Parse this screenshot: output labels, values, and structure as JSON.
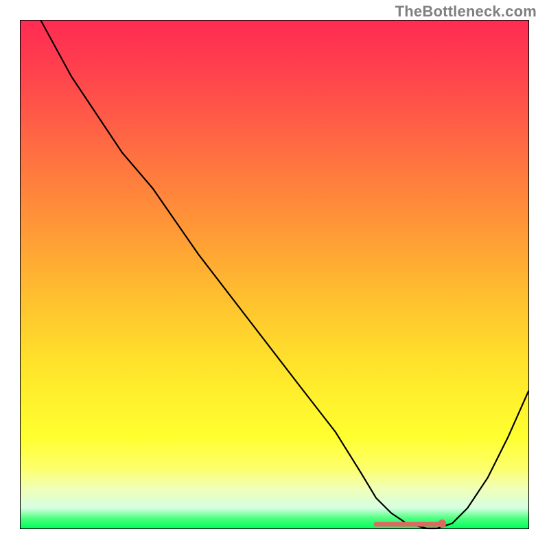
{
  "watermark": "TheBottleneck.com",
  "chart_data": {
    "type": "line",
    "title": "",
    "xlabel": "",
    "ylabel": "",
    "xlim": [
      0,
      100
    ],
    "ylim": [
      0,
      100
    ],
    "series": [
      {
        "name": "bottleneck-curve",
        "x": [
          4,
          10,
          20,
          26,
          35,
          45,
          55,
          62,
          67,
          70,
          73,
          76,
          80,
          82,
          85,
          88,
          92,
          96,
          100
        ],
        "values": [
          100,
          89,
          74,
          67,
          54,
          41,
          28,
          19,
          11,
          6,
          3,
          1,
          0,
          0,
          1,
          4,
          10,
          18,
          27
        ]
      }
    ],
    "annotations": {
      "minimum_range_x": [
        70,
        83
      ],
      "extra_dot_x": 83
    },
    "background_gradient": {
      "top": "#ff2c52",
      "mid": "#ffe12b",
      "bottom": "#00ff5c"
    }
  }
}
